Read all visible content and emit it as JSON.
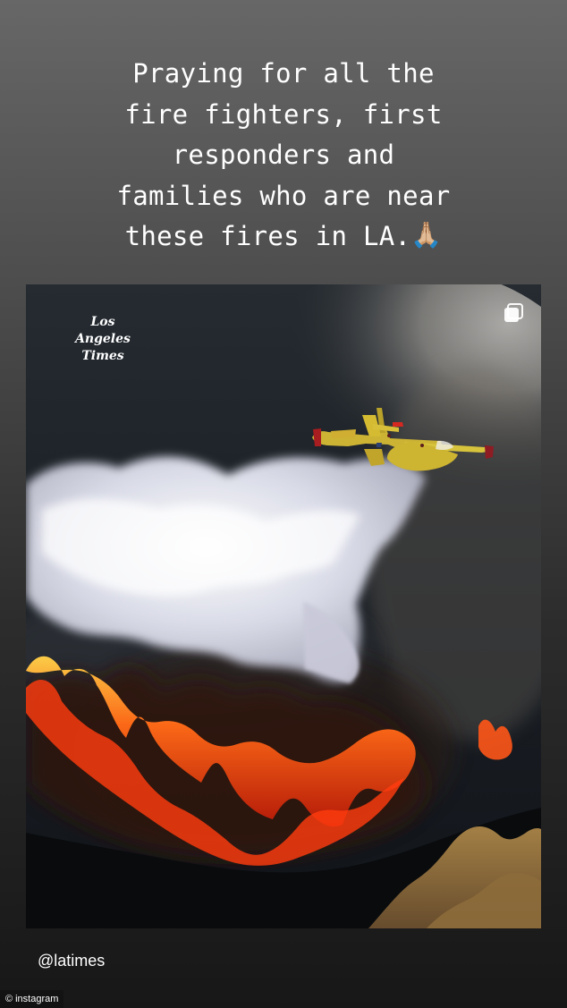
{
  "story": {
    "caption": "Praying for all the\nfire fighters, first\nresponders and\nfamilies who are near\nthese fires in LA.",
    "caption_emoji": "🙏🏼",
    "mention": "@latimes"
  },
  "post": {
    "publisher_logo": "Los\nAngeles\nTimes",
    "multi_post_icon": "square-stack-icon",
    "image_subject": "water-bomber-aircraft-drop-over-wildfire",
    "colors": {
      "sky_dark": "#1f252c",
      "smoke": "#8f8d89",
      "retardant": "#f0f1f7",
      "fire": "#ff4a12",
      "aircraft": "#d6ba32"
    }
  },
  "watermark": {
    "icon": "copyright-icon",
    "text": "instagram"
  }
}
